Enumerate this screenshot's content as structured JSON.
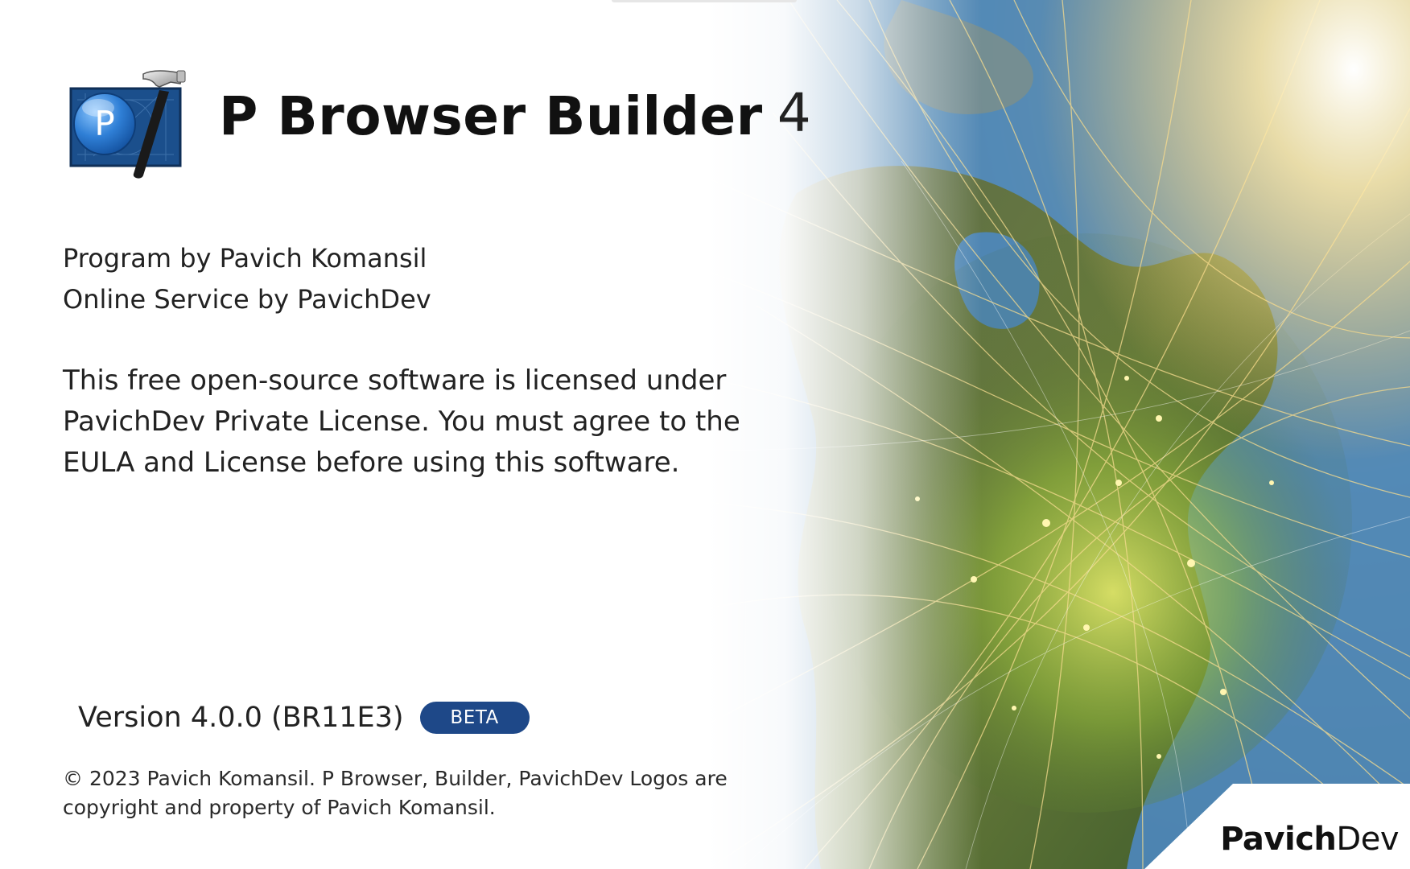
{
  "app": {
    "name": "P Browser Builder",
    "major_version": "4"
  },
  "credits": {
    "program": "Program by Pavich Komansil",
    "service": "Online Service by PavichDev"
  },
  "license": {
    "lines": [
      "This free open-source software is licensed under",
      "PavichDev Private License. You must agree to the",
      "EULA and License before using this software."
    ]
  },
  "version": {
    "text": "Version 4.0.0 (BR11E3)",
    "badge": "BETA"
  },
  "copyright": {
    "lines": [
      "© 2023 Pavich Komansil. P Browser, Builder, PavichDev Logos are",
      "copyright and property of Pavich Komansil."
    ]
  },
  "brand": {
    "bold": "Pavich",
    "regular": "Dev"
  },
  "colors": {
    "badge_background": "#1e4888",
    "logo_blue": "#1f63b5",
    "ocean": "#4c8ab8",
    "land_glow": "#9bbf3c",
    "network_lines": "#f3d98a"
  },
  "icons": {
    "app_logo": "p-circle-hammer-blueprint-icon",
    "hero": "earth-network-image"
  }
}
